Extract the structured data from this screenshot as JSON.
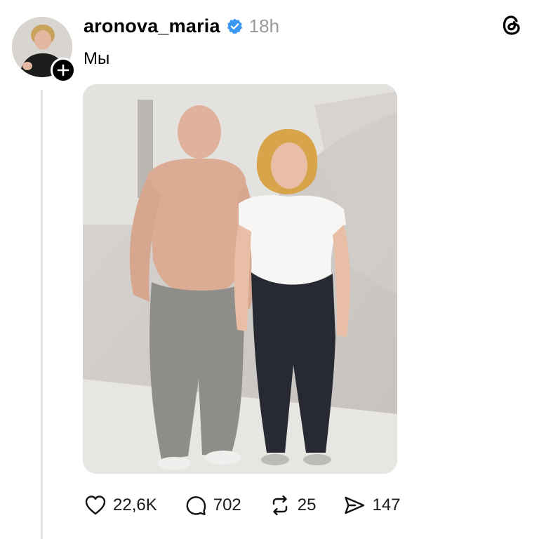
{
  "post": {
    "username": "aronova_maria",
    "time": "18h",
    "caption": "Мы",
    "verified_color": "#3897f0"
  },
  "actions": {
    "likes": "22,6K",
    "replies": "702",
    "reposts": "25",
    "shares": "147"
  },
  "icons": [
    "plus-icon",
    "verified-badge-icon",
    "threads-logo-icon",
    "heart-icon",
    "comment-icon",
    "repost-icon",
    "share-icon"
  ]
}
